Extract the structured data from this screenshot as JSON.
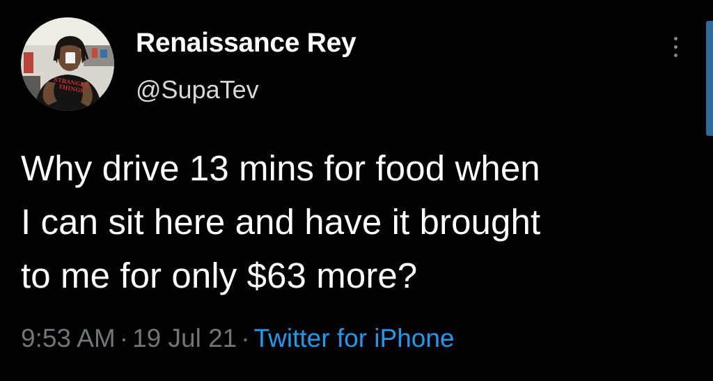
{
  "tweet": {
    "display_name": "Renaissance Rey",
    "handle": "@SupaTev",
    "text_lines": [
      "Why drive 13 mins for food when",
      "I can sit here and have it brought",
      "to me for only $63 more?"
    ],
    "time": "9:53 AM",
    "date": "19 Jul 21",
    "separator": "·",
    "source": "Twitter for iPhone",
    "avatar_shirt_text": [
      "STRANGER",
      "THINGS"
    ],
    "more_icon": "more-vertical-icon"
  },
  "colors": {
    "background": "#000000",
    "primary_text": "#ffffff",
    "secondary_text": "#71767b",
    "link": "#1d9bf0",
    "scroll_indicator": "#2f6a99"
  }
}
